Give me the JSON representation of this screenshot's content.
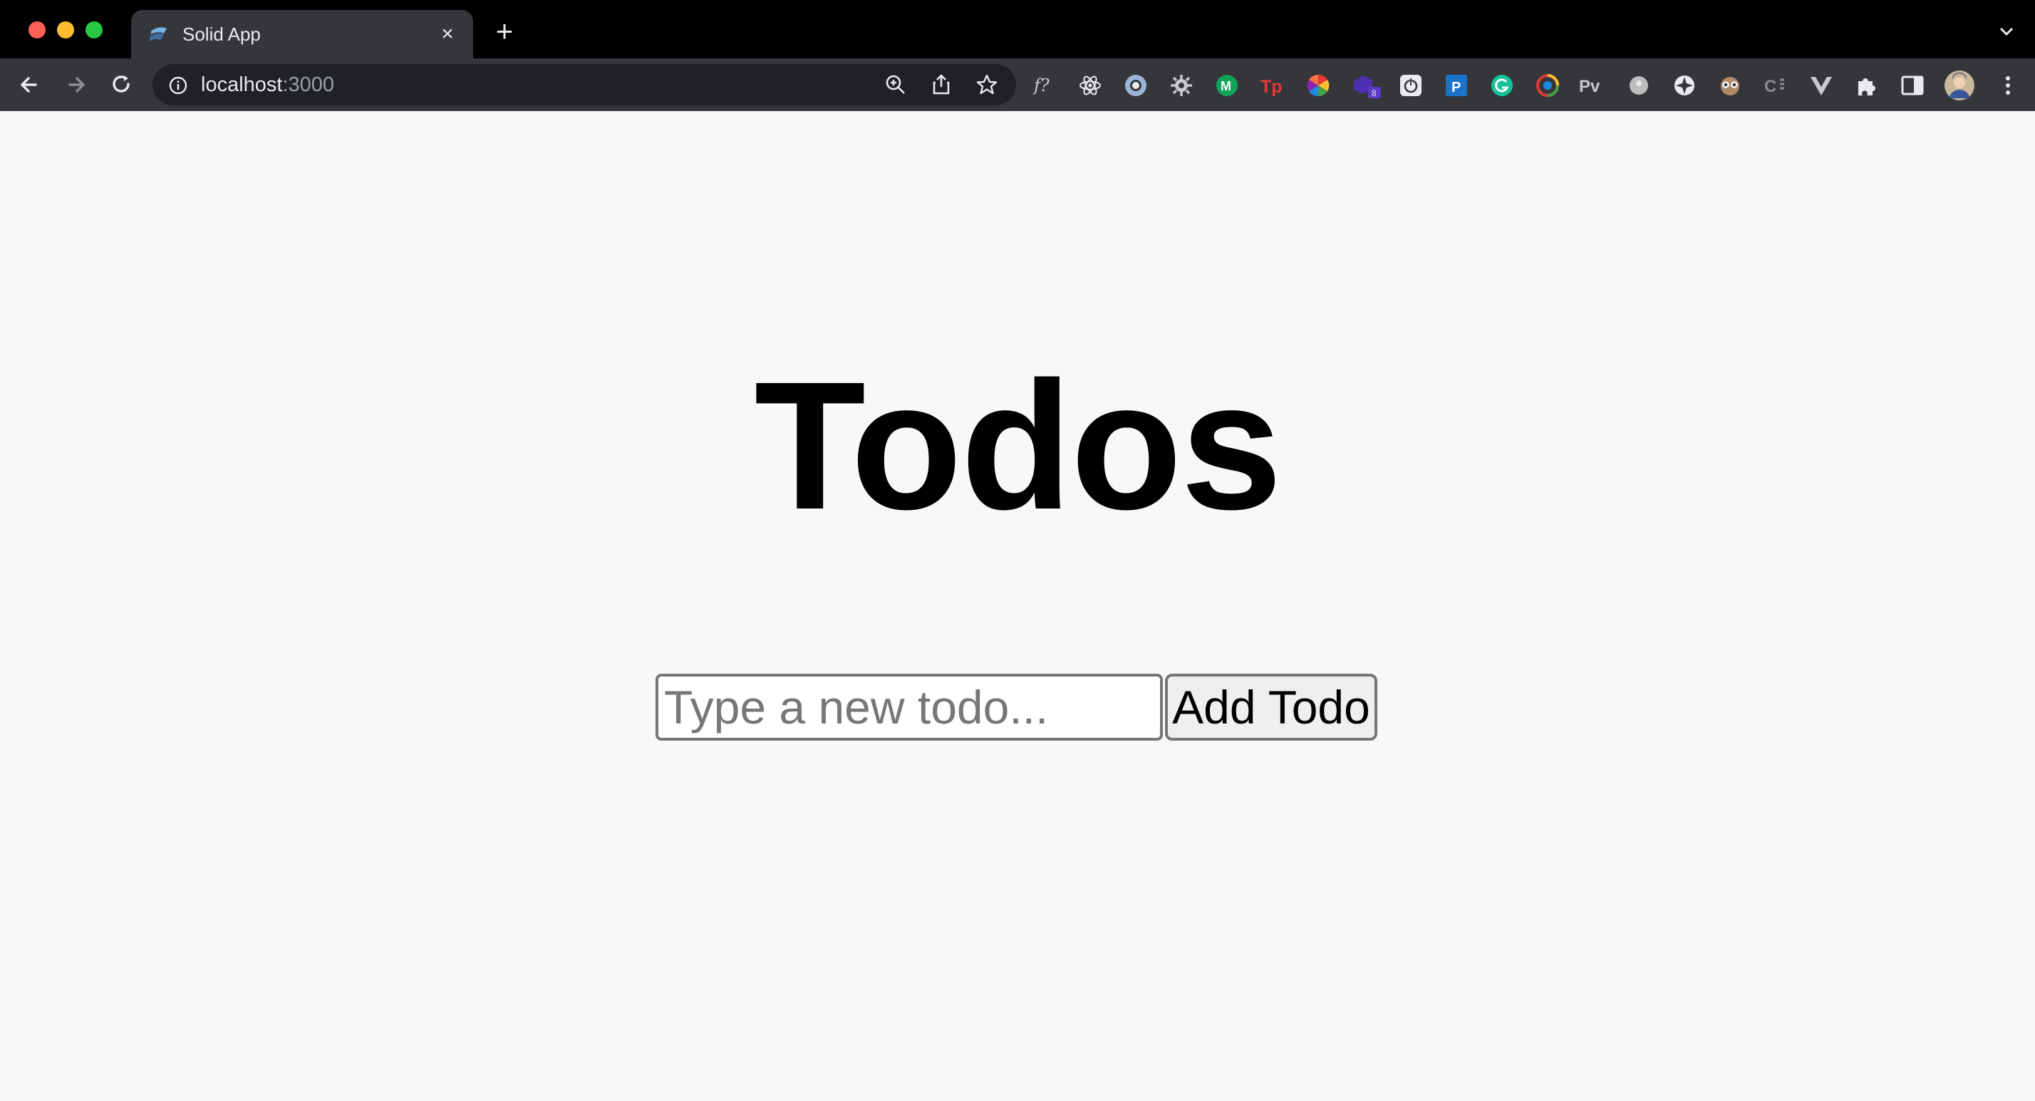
{
  "browser": {
    "tab": {
      "title": "Solid App"
    },
    "address": {
      "host": "localhost",
      "port": ":3000"
    },
    "extensions": [
      "font-identifier-icon",
      "react-devtools-icon",
      "circle-extension-icon",
      "gear-extension-icon",
      "green-extension-icon",
      "tp-extension-icon",
      "color-wheel-icon",
      "badge-extension-icon",
      "power-extension-icon",
      "p-extension-icon",
      "grammarly-icon",
      "chrome-ring-icon",
      "pv-extension-icon",
      "grey-dot-icon",
      "blade-icon",
      "mascot-icon",
      "css-extension-icon",
      "vue-devtools-icon",
      "puzzle-icon",
      "sidepanel-icon"
    ],
    "extension_badge": "8",
    "pv_label": "Pv",
    "colors": {
      "chrome_dark": "#35363a",
      "omnibox": "#202124",
      "page_bg": "#f8f8f8"
    }
  },
  "page": {
    "heading": "Todos",
    "input": {
      "placeholder": "Type a new todo...",
      "value": ""
    },
    "add_button_label": "Add Todo"
  }
}
